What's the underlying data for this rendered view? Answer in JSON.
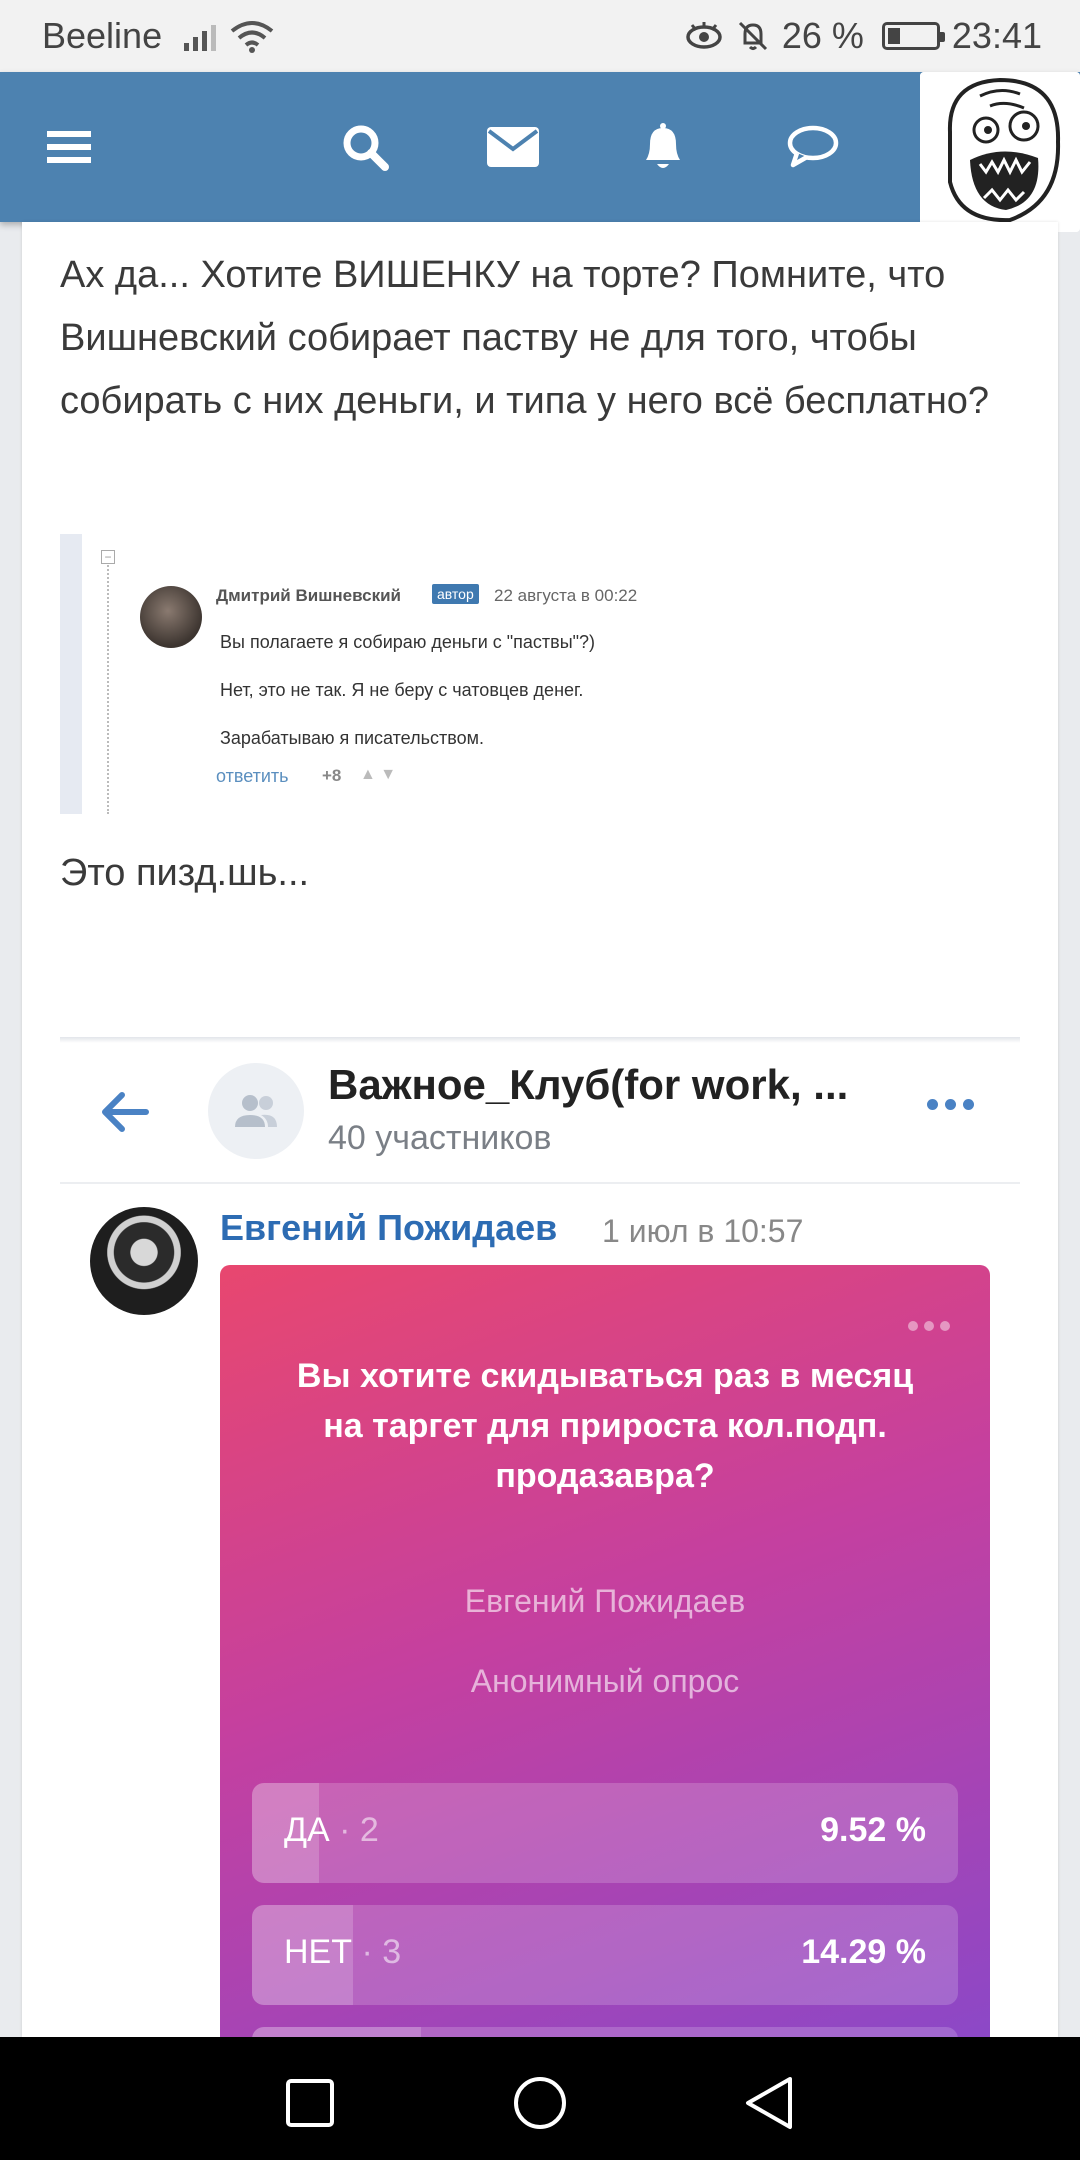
{
  "status_bar": {
    "carrier": "Beeline",
    "battery_percent": "26 %",
    "battery_level": 0.26,
    "time": "23:41"
  },
  "top_nav": {
    "icons": [
      "menu-icon",
      "search-icon",
      "mail-icon",
      "bell-icon",
      "chat-icon"
    ]
  },
  "post": {
    "paragraph_1": "Ах да... Хотите ВИШЕНКУ на торте? Помните, что Вишневский собирает паству не для того, чтобы собирать с них деньги, и типа у него всё бесплатно?",
    "paragraph_2": "Это пизд.шь..."
  },
  "quoted_comment": {
    "author": "Дмитрий Вишневский",
    "badge": "автор",
    "date": "22 августа в 00:22",
    "lines": [
      "Вы полагаете я собираю деньги с \"паствы\"?)",
      "Нет, это не так. Я не беру с чатовцев денег.",
      "Зарабатываю я писательством."
    ],
    "reply_label": "ответить",
    "votes": "+8"
  },
  "chat": {
    "title": "Важное_Клуб(for work, ...",
    "subtitle": "40 участников",
    "message": {
      "author": "Евгений Пожидаев",
      "time": "1 июл в 10:57"
    },
    "poll": {
      "question": "Вы хотите скидываться раз в месяц на  таргет для прироста кол.подп. продазавра?",
      "author": "Евгений Пожидаев",
      "type": "Анонимный опрос",
      "options": [
        {
          "label": "ДА",
          "count": " · 2",
          "percent": "9.52 %",
          "fraction": 0.0952
        },
        {
          "label": "НЕТ",
          "count": " · 3",
          "percent": "14.29 %",
          "fraction": 0.1429
        }
      ]
    }
  },
  "colors": {
    "nav_blue": "#4d82b0",
    "vk_blue": "#2d6cb3",
    "poll_start": "#e8476f",
    "poll_end": "#8a48c8"
  }
}
